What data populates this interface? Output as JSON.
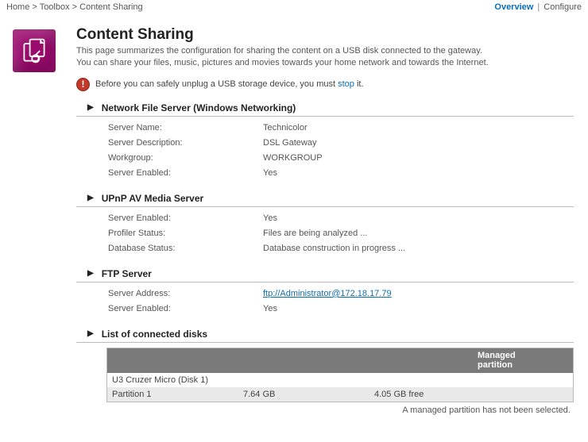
{
  "breadcrumb": {
    "home": "Home",
    "toolbox": "Toolbox",
    "current": "Content Sharing"
  },
  "tabs": {
    "overview": "Overview",
    "configure": "Configure"
  },
  "title": "Content Sharing",
  "lead1": "This page summarizes the configuration for sharing the content on a USB disk connected to the gateway.",
  "lead2": "You can share your files, music, pictures and movies towards your home network and towards the Internet.",
  "notice": {
    "pre": "Before you can safely unplug a USB storage device, you must ",
    "stop": "stop",
    "post": " it."
  },
  "nfs": {
    "heading": "Network File Server (Windows Networking)",
    "labels": {
      "name": "Server Name:",
      "desc": "Server Description:",
      "wg": "Workgroup:",
      "enabled": "Server Enabled:"
    },
    "values": {
      "name": "Technicolor",
      "desc": "DSL Gateway",
      "wg": "WORKGROUP",
      "enabled": "Yes"
    }
  },
  "upnp": {
    "heading": "UPnP AV Media Server",
    "labels": {
      "enabled": "Server Enabled:",
      "profiler": "Profiler Status:",
      "db": "Database Status:"
    },
    "values": {
      "enabled": "Yes",
      "profiler": "Files are being analyzed ...",
      "db": "Database construction in progress ..."
    }
  },
  "ftp": {
    "heading": "FTP Server",
    "labels": {
      "addr": "Server Address:",
      "enabled": "Server Enabled:"
    },
    "values": {
      "addr": "ftp://Administrator@172.18.17.79",
      "enabled": "Yes"
    }
  },
  "disks": {
    "heading": "List of connected disks",
    "col_managed": "Managed partition",
    "disk_name": "U3 Cruzer Micro (Disk 1)",
    "part": "Partition 1",
    "size": "7.64 GB",
    "free": "4.05 GB free",
    "footer": "A managed partition has not been selected."
  }
}
